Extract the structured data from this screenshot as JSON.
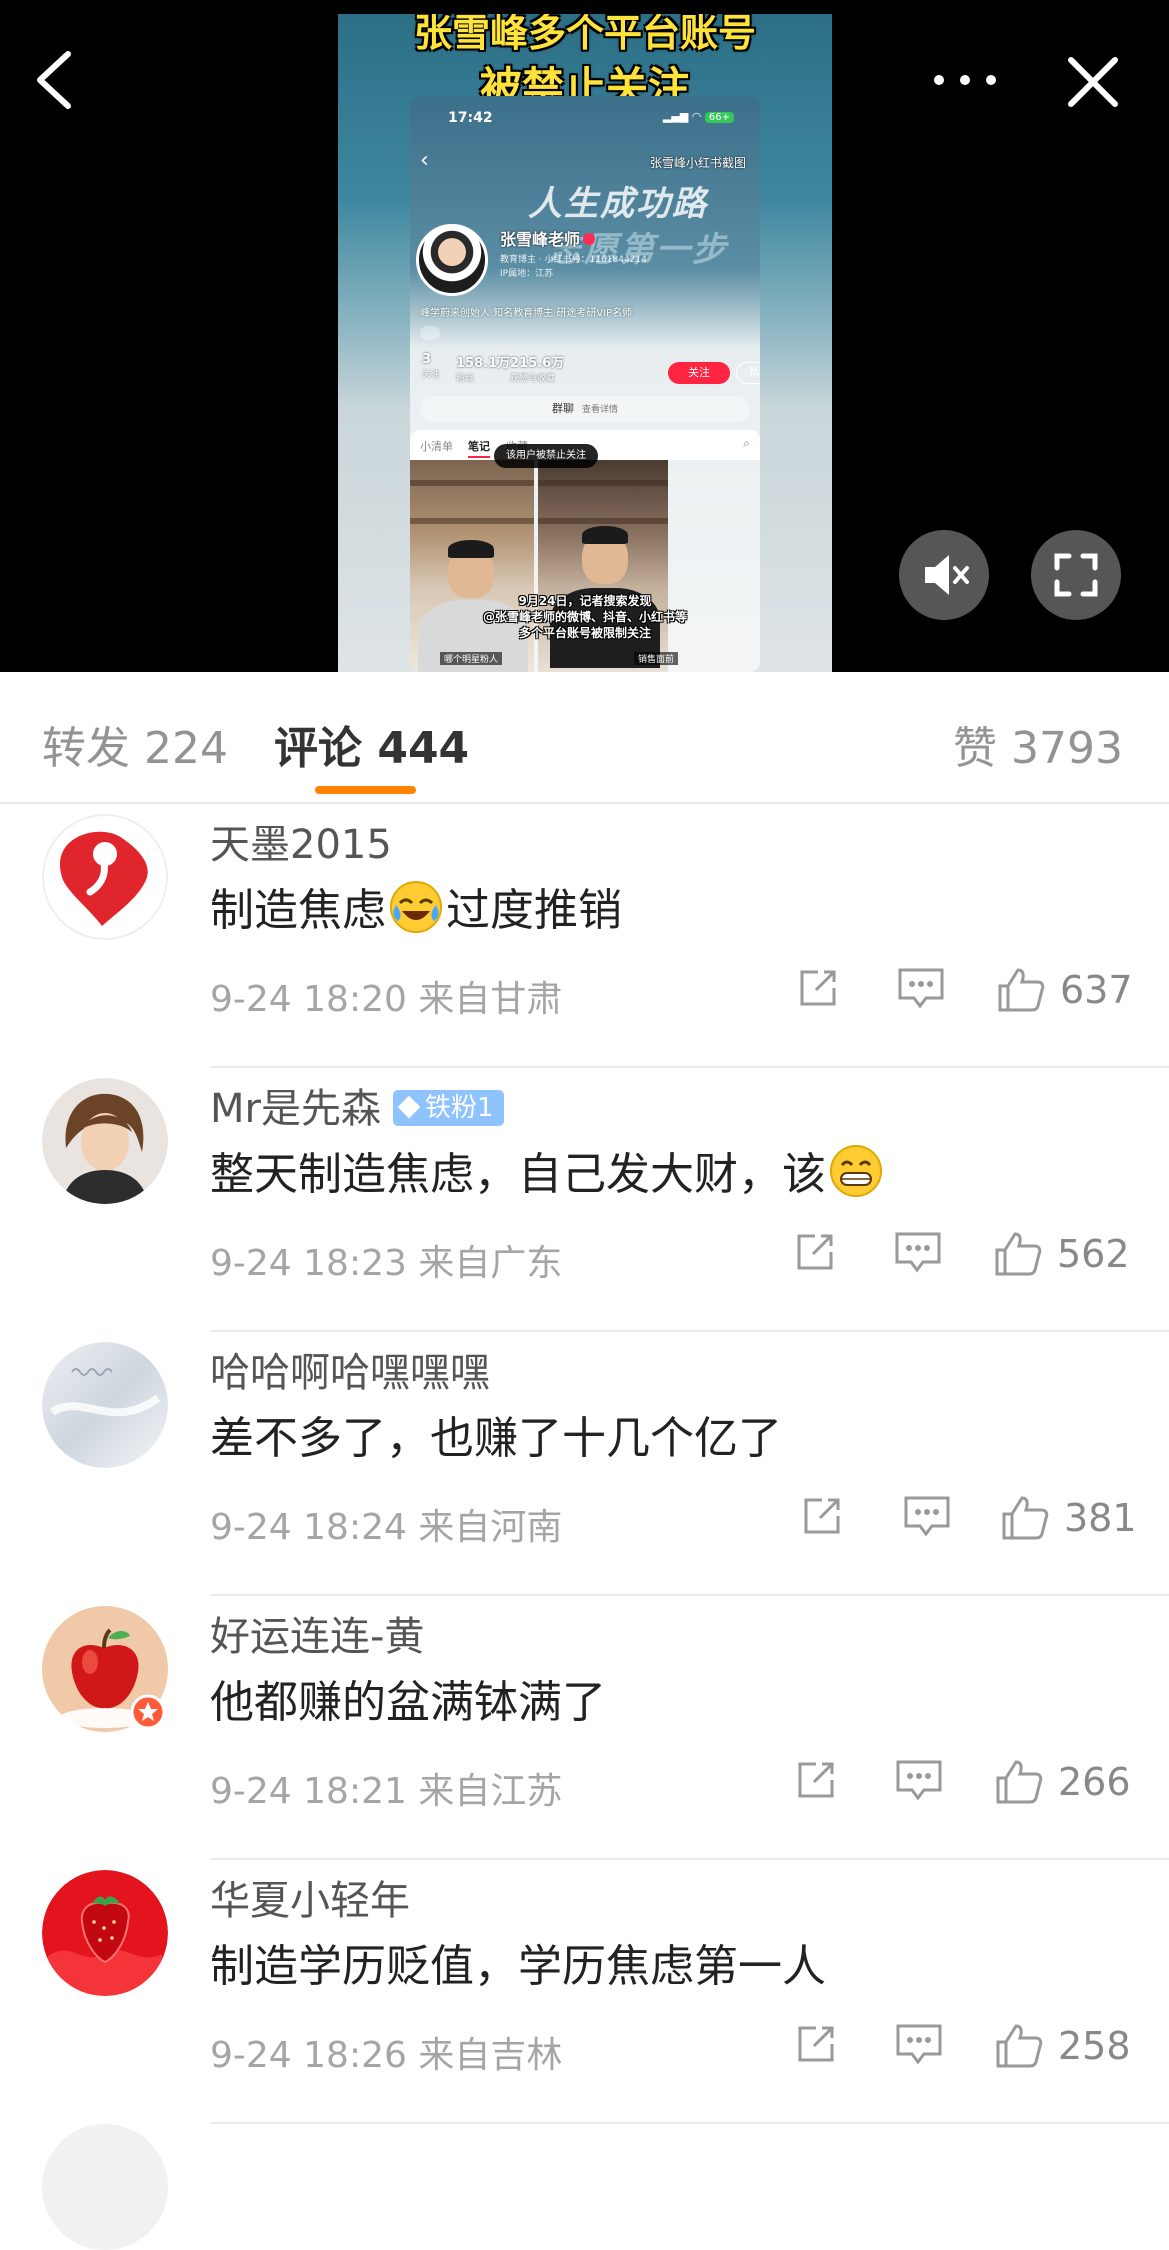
{
  "video": {
    "headline_line1": "张雪峰多个平台账号",
    "headline_line2": "被禁止关注",
    "inner_screenshot": {
      "status_time": "17:42",
      "status_battery": "66+",
      "source_label": "张雪峰小红书截图",
      "slogan_line1": "人生成功路",
      "slogan_line2": "志愿第一步",
      "profile_name": "张雪峰老师",
      "profile_meta": "教育博主 · 小红书号：1161844214",
      "profile_ip": "IP属地：江苏",
      "profile_bio": "峰学蔚来创始人 知名教育博主 研途考研VIP名师",
      "stats": [
        {
          "value": "3",
          "label": "关注"
        },
        {
          "value": "158.1万",
          "label": "粉丝"
        },
        {
          "value": "215.6万",
          "label": "获赞与收藏"
        }
      ],
      "follow_button": "关注",
      "message_button": "私信",
      "group_chat": "群聊",
      "group_chat_sub": "查看详情",
      "tabs": [
        "小清单",
        "笔记",
        "收藏"
      ],
      "active_tab": "笔记",
      "toast": "该用户被禁止关注",
      "caption_line1": "9月24日，记者搜索发现",
      "caption_line2": "@张雪峰老师的微博、抖音、小红书等",
      "caption_line3": "多个平台账号被限制关注",
      "thumb_label_left": "哪个明星粉人",
      "thumb_label_right": "销售面前"
    }
  },
  "tabs": {
    "repost_label": "转发",
    "repost_count": "224",
    "comments_label": "评论",
    "comments_count": "444",
    "likes_label": "赞",
    "likes_count": "3793",
    "active": "comments"
  },
  "comments": [
    {
      "user": "天墨2015",
      "text_before": "制造焦虑",
      "emoji": "crying-laughing",
      "text_after": "过度推销",
      "time": "9-24 18:20",
      "location": "来自甘肃",
      "likes": "637"
    },
    {
      "user": "Mr是先森",
      "badge": "铁粉1",
      "text_before": "整天制造焦虑，自己发大财，该",
      "emoji": "grinning",
      "text_after": "",
      "time": "9-24 18:23",
      "location": "来自广东",
      "likes": "562"
    },
    {
      "user": "哈哈啊哈嘿嘿嘿",
      "text_before": "差不多了，也赚了十几个亿了",
      "time": "9-24 18:24",
      "location": "来自河南",
      "likes": "381"
    },
    {
      "user": "好运连连-黄",
      "text_before": "他都赚的盆满钵满了",
      "time": "9-24 18:21",
      "location": "来自江苏",
      "likes": "266"
    },
    {
      "user": "华夏小轻年",
      "text_before": "制造学历贬值，学历焦虑第一人",
      "time": "9-24 18:26",
      "location": "来自吉林",
      "likes": "258"
    }
  ],
  "colors": {
    "accent_orange": "#ff8200",
    "badge_blue": "#8ec3ff",
    "meta_gray": "#a5a5a5"
  },
  "icons": [
    "back-arrow-icon",
    "more-dots-icon",
    "close-icon",
    "mute-icon",
    "fullscreen-icon",
    "share-icon",
    "reply-icon",
    "like-icon"
  ]
}
